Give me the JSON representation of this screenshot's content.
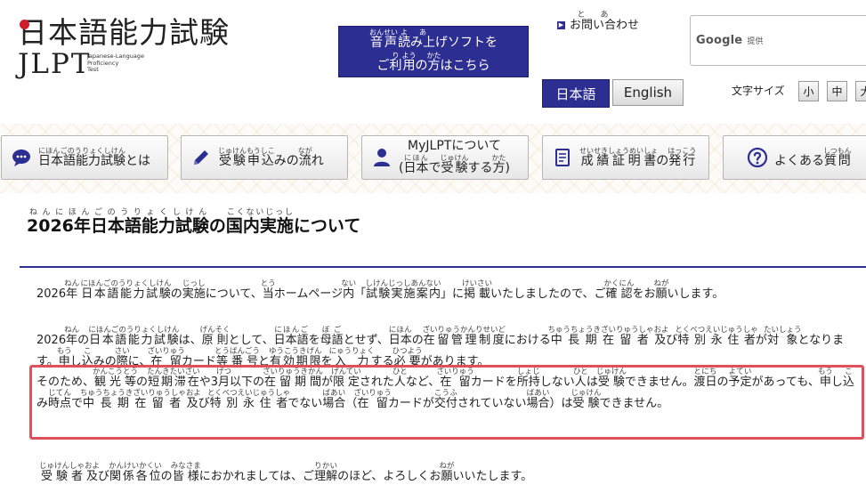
{
  "header": {
    "logo_jp": "日本語能力試験",
    "logo_en": "JLPT",
    "logo_sub_lines": [
      "Japanese-Language",
      "Proficiency",
      "Test"
    ],
    "tts_line1": "音声読み上げソフトを",
    "tts_line2": "ご利用の方はこちら",
    "contact": "お問い合わせ",
    "search_brand": "Google",
    "search_powered": "提供",
    "lang_ja": "日本語",
    "lang_en": "English",
    "font_size_label": "文字サイズ",
    "font_small": "小",
    "font_medium": "中",
    "font_large": "大"
  },
  "nav": [
    {
      "label": "日本語能力試験とは",
      "icon": "chat-bubble-icon"
    },
    {
      "label": "受験申込みの流れ",
      "icon": "pencil-icon"
    },
    {
      "label_line1": "MyJLPTについて",
      "label_line2": "(日本で受験する方)",
      "icon": "user-icon"
    },
    {
      "label": "成績証明書の発行",
      "icon": "document-icon"
    },
    {
      "label": "よくある質問",
      "icon": "question-icon"
    }
  ],
  "main": {
    "title": "2026年日本語能力試験の国内実施について"
  },
  "colors": {
    "brand": "#2d2e92",
    "highlight": "#e0505a",
    "logo_red": "#d01c2a"
  }
}
